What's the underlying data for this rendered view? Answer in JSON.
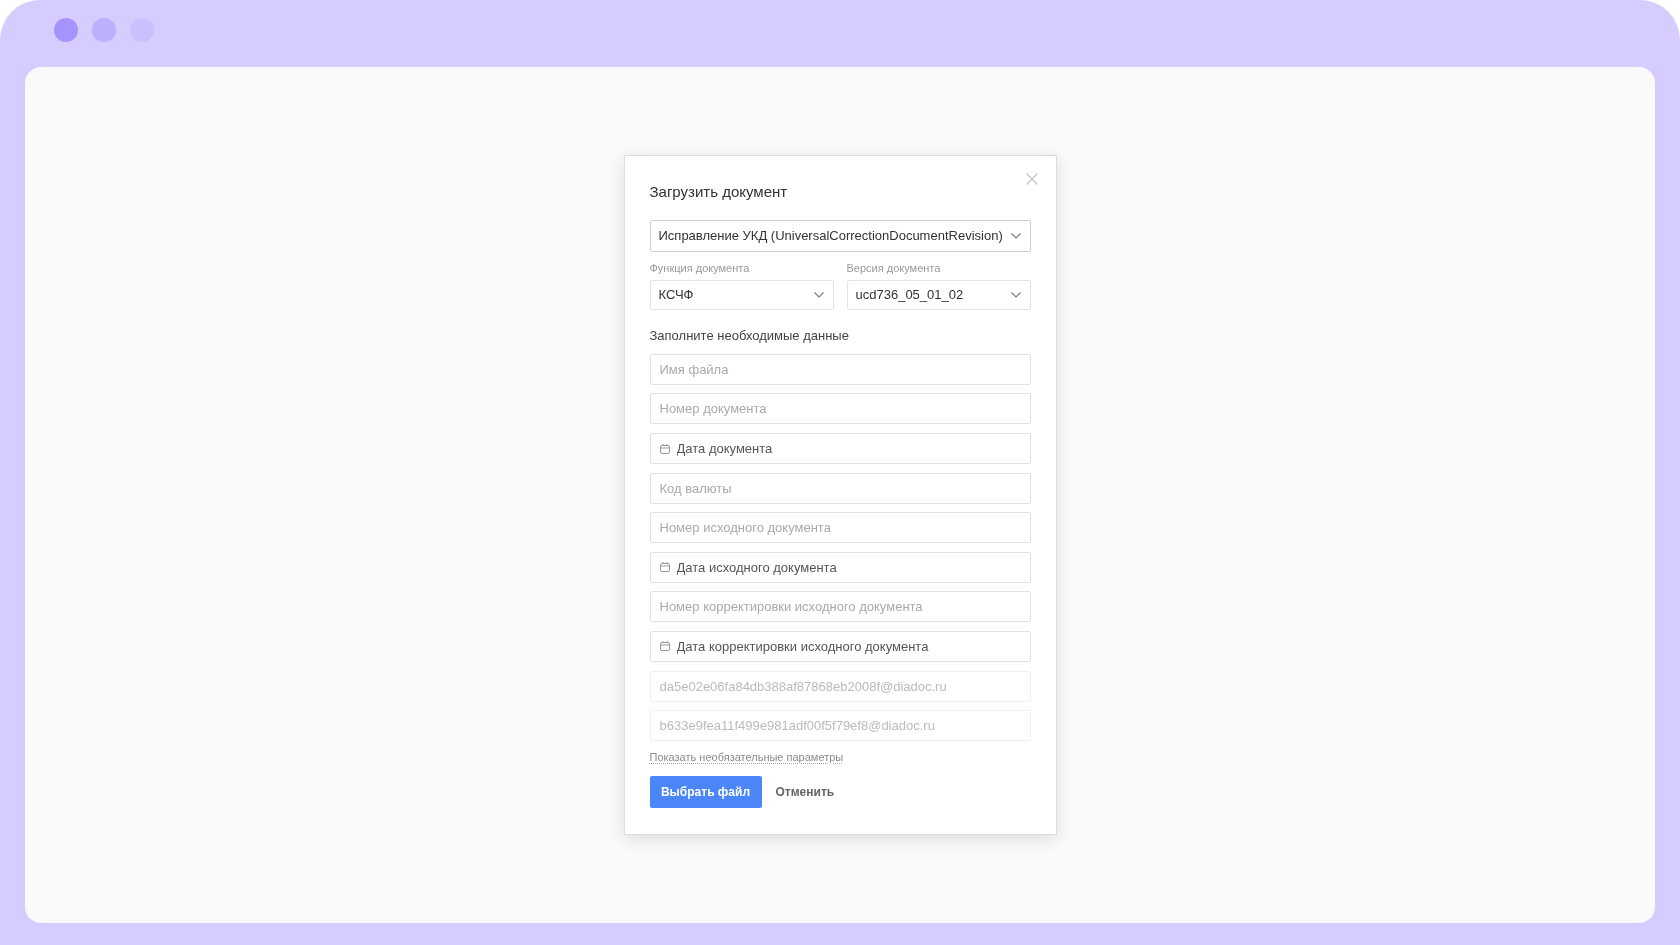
{
  "window": {
    "dots": [
      {
        "color": "#a594fd"
      },
      {
        "color": "#bcaffd"
      },
      {
        "color": "#cbc0fe"
      }
    ]
  },
  "dialog": {
    "title": "Загрузить документ",
    "document_type": {
      "value": "Исправление УКД (UniversalCorrectionDocumentRevision)"
    },
    "document_function": {
      "label": "Функция документа",
      "value": "КСЧФ"
    },
    "document_version": {
      "label": "Версия документа",
      "value": "ucd736_05_01_02"
    },
    "section_title": "Заполните необходимые данные",
    "fields": [
      {
        "kind": "text",
        "placeholder": "Имя файла",
        "disabled": false
      },
      {
        "kind": "text",
        "placeholder": "Номер документа",
        "disabled": false
      },
      {
        "kind": "date",
        "placeholder": "Дата документа",
        "disabled": false
      },
      {
        "kind": "text",
        "placeholder": "Код валюты",
        "disabled": false
      },
      {
        "kind": "text",
        "placeholder": "Номер исходного документа",
        "disabled": false
      },
      {
        "kind": "date",
        "placeholder": "Дата исходного документа",
        "disabled": false
      },
      {
        "kind": "text",
        "placeholder": "Номер корректировки исходного документа",
        "disabled": false
      },
      {
        "kind": "date",
        "placeholder": "Дата корректировки исходного документа",
        "disabled": false
      },
      {
        "kind": "text",
        "value": "da5e02e06fa84db388af87868eb2008f@diadoc.ru",
        "disabled": true
      },
      {
        "kind": "text",
        "value": "b633e9fea11f499e981adf00f5f79ef8@diadoc.ru",
        "disabled": true
      }
    ],
    "optional_link": "Показать необязательные параметры",
    "buttons": [
      {
        "kind": "primary",
        "label": "Выбрать файл"
      },
      {
        "kind": "secondary",
        "label": "Отменить"
      }
    ]
  }
}
